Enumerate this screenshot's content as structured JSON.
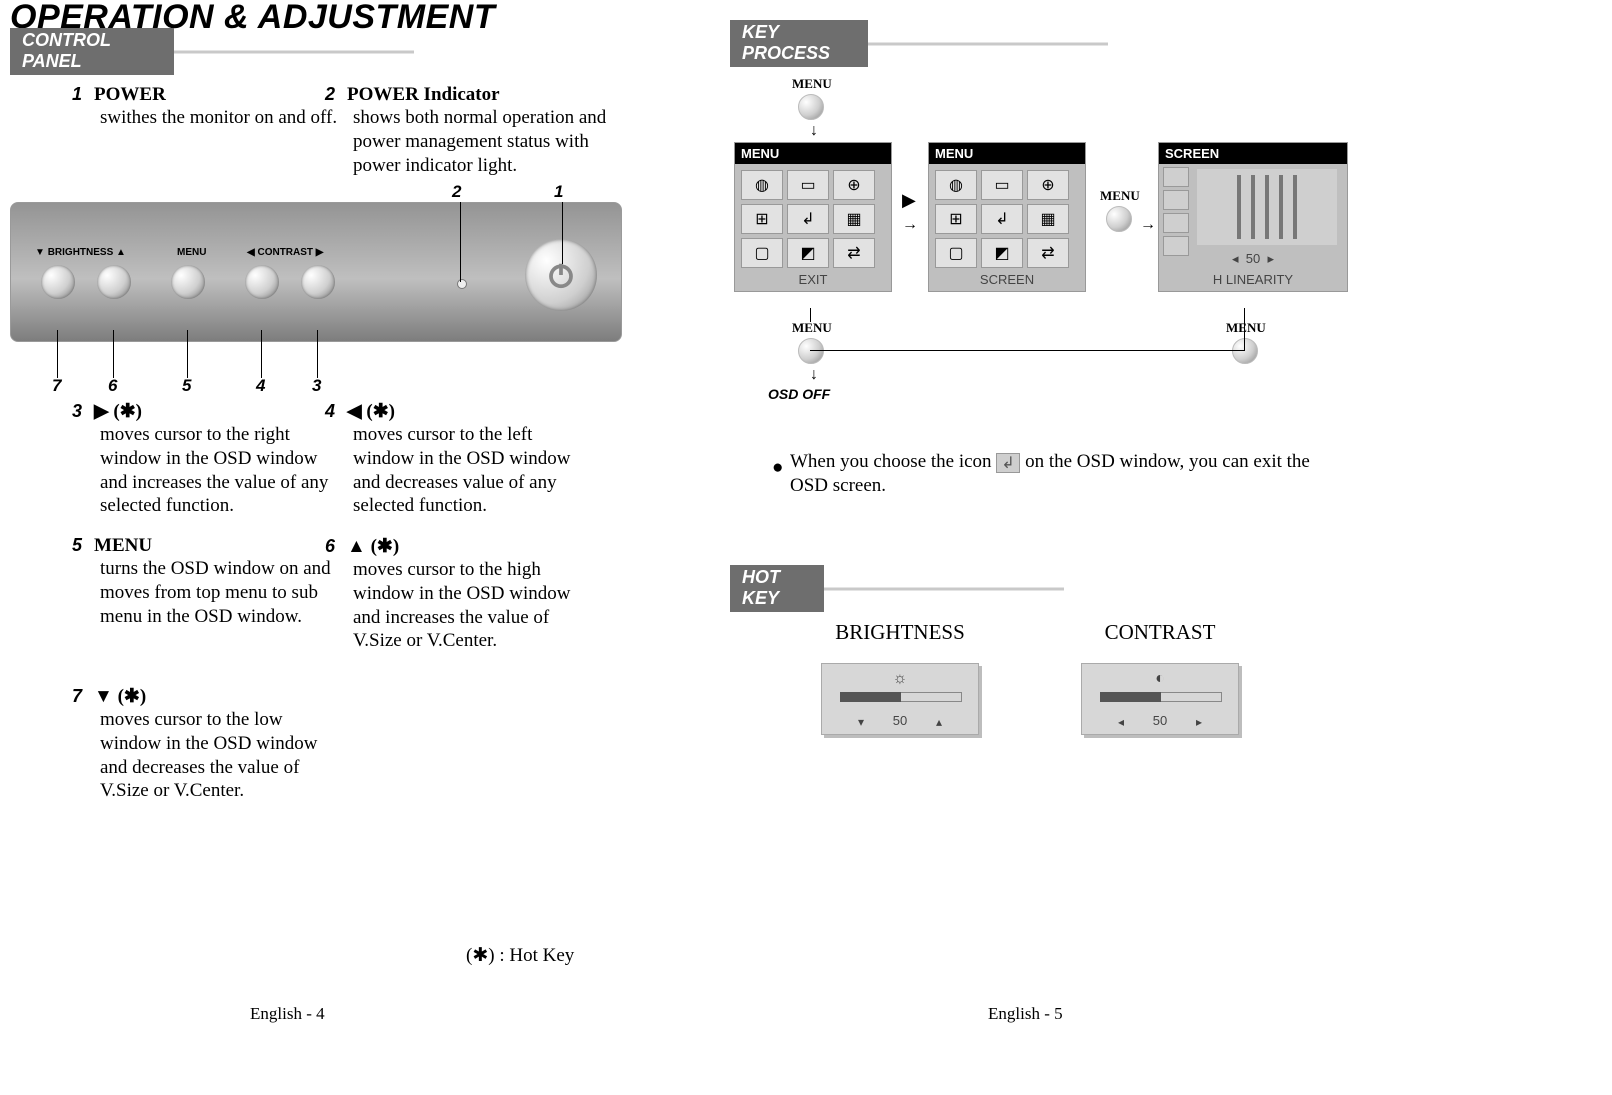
{
  "title": "OPERATION & ADJUSTMENT",
  "sections": {
    "control_panel": "CONTROL PANEL",
    "key_process": "KEY PROCESS",
    "hot_key": "HOT KEY"
  },
  "panel_labels": {
    "brightness": "BRIGHTNESS",
    "menu": "MENU",
    "contrast": "CONTRAST"
  },
  "items": [
    {
      "n": "1",
      "title": "POWER",
      "desc": "swithes the monitor on and off."
    },
    {
      "n": "2",
      "title": "POWER Indicator",
      "desc": "shows both normal operation and power management status with power indicator light."
    },
    {
      "n": "3",
      "title": "▶ (✱)",
      "desc": "moves cursor to the right window in the OSD window and increases the value of any selected function."
    },
    {
      "n": "4",
      "title": "◀ (✱)",
      "desc": "moves cursor to the left window in the OSD window and decreases value of any selected  function."
    },
    {
      "n": "5",
      "title": "MENU",
      "desc": "turns the OSD window on and moves from top menu to sub menu in the OSD window."
    },
    {
      "n": "6",
      "title": "▲ (✱)",
      "desc": "moves cursor to the high window in the OSD window and increases the value of V.Size or V.Center."
    },
    {
      "n": "7",
      "title": "▼ (✱)",
      "desc": "moves cursor to the low window in the OSD window and decreases the value of V.Size or V.Center."
    }
  ],
  "footnote": "(✱) : Hot Key",
  "page_left": "English - 4",
  "page_right": "English - 5",
  "kp": {
    "menu_label": "MENU",
    "osd_title_menu": "MENU",
    "osd_title_screen": "SCREEN",
    "osd_footer_exit": "EXIT",
    "osd_footer_screen": "SCREEN",
    "hlin_value": "50",
    "hlin_label": "H LINEARITY",
    "osd_off": "OSD OFF"
  },
  "note": "When you choose the icon       on the OSD window, you can exit the OSD screen.",
  "hotkey": {
    "brightness": {
      "label": "BRIGHTNESS",
      "value": "50",
      "icon": "☼",
      "left": "▾",
      "right": "▴"
    },
    "contrast": {
      "label": "CONTRAST",
      "value": "50",
      "icon": "◐",
      "left": "◂",
      "right": "▸"
    }
  }
}
